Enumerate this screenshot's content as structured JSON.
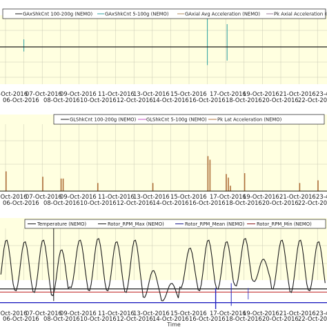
{
  "chart_data": [
    {
      "type": "line",
      "panel": "top",
      "legend": [
        {
          "name": "GAxShkCnt 100-200g (NEMO)",
          "color": "#1a1a1a"
        },
        {
          "name": "GAxShkCnt 5-100g (NEMO)",
          "color": "#2aa0a0"
        },
        {
          "name": "GAxial Avg Acceleration (NEMO)",
          "color": "#b08a5a"
        },
        {
          "name": "Pk Axial Acceleration (NEMO)",
          "color": "#9a7a9a"
        }
      ],
      "legend_placement": "top",
      "grid": true,
      "baseline": 0,
      "spikes": [
        {
          "date": "2016-10-07",
          "value": 1,
          "series": 1
        },
        {
          "date": "2016-10-17",
          "value": 4,
          "series": 1
        },
        {
          "date": "2016-10-18",
          "value": 3,
          "series": 1
        }
      ]
    },
    {
      "type": "bar",
      "panel": "middle",
      "legend": [
        {
          "name": "GLShkCnt 100-200g (NEMO)",
          "color": "#1a1a1a"
        },
        {
          "name": "GLShkCnt 5-100g (NEMO)",
          "color": "#c04fc0"
        },
        {
          "name": "Pk Lat Acceleration (NEMO)",
          "color": "#b0703a"
        }
      ],
      "legend_placement": "top",
      "grid": true,
      "spikes": [
        {
          "date": "2016-10-05",
          "value": 2.0
        },
        {
          "date": "2016-10-05",
          "value": 1.1
        },
        {
          "date": "2016-10-06",
          "value": 2.2
        },
        {
          "date": "2016-10-08",
          "value": 1.6
        },
        {
          "date": "2016-10-09",
          "value": 1.4
        },
        {
          "date": "2016-10-09",
          "value": 1.4
        },
        {
          "date": "2016-10-11",
          "value": 0.9
        },
        {
          "date": "2016-10-14",
          "value": 0.9
        },
        {
          "date": "2016-10-17",
          "value": 3.9
        },
        {
          "date": "2016-10-17",
          "value": 3.5
        },
        {
          "date": "2016-10-18",
          "value": 1.9
        },
        {
          "date": "2016-10-18",
          "value": 1.5
        },
        {
          "date": "2016-10-18",
          "value": 0.6
        },
        {
          "date": "2016-10-19",
          "value": 2.0
        },
        {
          "date": "2016-10-22",
          "value": 0.9
        },
        {
          "date": "2016-10-23",
          "value": 1.2
        }
      ]
    },
    {
      "type": "line",
      "panel": "bottom",
      "legend": [
        {
          "name": "Temperature (NEMO)",
          "color": "#1a1a1a"
        },
        {
          "name": "Rotor_RPM_Max (NEMO)",
          "color": "#1a1a1a"
        },
        {
          "name": "Rotor_RPM_Mean (NEMO)",
          "color": "#1a1a8c"
        },
        {
          "name": "Rotor_RPM_Min (NEMO)",
          "color": "#8c1a1a"
        }
      ],
      "legend_placement": "top",
      "grid": true,
      "xlabel": "Time",
      "temperature_daily": [
        {
          "date": "2016-10-05",
          "high": 4.4,
          "low": 0.9
        },
        {
          "date": "2016-10-06",
          "high": 4.3,
          "low": 1.0
        },
        {
          "date": "2016-10-07",
          "high": 4.2,
          "low": 1.1
        },
        {
          "date": "2016-10-08",
          "high": 4.3,
          "low": 1.0
        },
        {
          "date": "2016-10-09",
          "high": 3.7,
          "low": 0.8
        },
        {
          "date": "2016-10-10",
          "high": 4.3,
          "low": 1.3
        },
        {
          "date": "2016-10-11",
          "high": 4.4,
          "low": 1.1
        },
        {
          "date": "2016-10-12",
          "high": 4.2,
          "low": 1.1
        },
        {
          "date": "2016-10-13",
          "high": 4.3,
          "low": 1.0
        },
        {
          "date": "2016-10-14",
          "high": 2.4,
          "low": 0.7
        },
        {
          "date": "2016-10-15",
          "high": 1.6,
          "low": 0.5
        },
        {
          "date": "2016-10-16",
          "high": 3.8,
          "low": 1.3
        },
        {
          "date": "2016-10-17",
          "high": 4.3,
          "low": 1.1
        },
        {
          "date": "2016-10-18",
          "high": 4.2,
          "low": 1.2
        },
        {
          "date": "2016-10-19",
          "high": 4.4,
          "low": 1.4
        },
        {
          "date": "2016-10-20",
          "high": 3.1,
          "low": 1.7
        },
        {
          "date": "2016-10-21",
          "high": 4.3,
          "low": 1.2
        },
        {
          "date": "2016-10-22",
          "high": 4.3,
          "low": 1.0
        },
        {
          "date": "2016-10-23",
          "high": 4.2,
          "low": 1.1
        }
      ],
      "rotor_rpm_max_level": 1.25,
      "rotor_rpm_mean_level": 0.4,
      "rotor_rpm_min_level": 1.05,
      "marker": {
        "date": "2016-10-09"
      }
    }
  ],
  "x_axis": {
    "row1_ticks": [
      "07-Oct-2016",
      "09-Oct-2016",
      "11-Oct-2016",
      "13-Oct-2016",
      "15-Oct-2016",
      "17-Oct-2016",
      "19-Oct-2016",
      "21-Oct-2016"
    ],
    "row2_ticks": [
      "06-Oct-2016",
      "08-Oct-2016",
      "10-Oct-2016",
      "12-Oct-2016",
      "14-Oct-2016",
      "16-Oct-2016",
      "18-Oct-2016",
      "20-Oct-2016",
      "22-Oct-2016"
    ],
    "panel_top_row1": [
      "-Oct-2016",
      "07-Oct-2016",
      "09-Oct-2016",
      "11-Oct-2016",
      "13-Oct-2016",
      "15-Oct-2016",
      "17-Oct-2016",
      "19-Oct-2016",
      "21-Oct-2016",
      "23-4"
    ],
    "panel_top_row2": [
      "06-Oct-2016",
      "08-Oct-2016",
      "10-Oct-2016",
      "12-Oct-2016",
      "14-Oct-2016",
      "16-Oct-2016",
      "18-Oct-2016",
      "20-Oct-2016",
      "22-Oct-201"
    ],
    "panel_mid_row1": [
      "6-Oct-2016",
      "07-Oct-2016",
      "09-Oct-2016",
      "11-Oct-2016",
      "13-Oct-2016",
      "15-Oct-2016",
      "17-Oct-2016",
      "19-Oct-2016",
      "21-Oct-2016",
      "23-4"
    ],
    "panel_mid_row2": [
      "06-Oct-2016",
      "08-Oct-2016",
      "10-Oct-2016",
      "12-Oct-2016",
      "14-Oct-2016",
      "16-Oct-2016",
      "18-Oct-2016",
      "20-Oct-2016",
      "22-Oct-201"
    ],
    "panel_bot_row1": [
      "6-Oct-2016",
      "07-Oct-2016",
      "09-Oct-2016",
      "11-Oct-2016",
      "13-Oct-2016",
      "15-Oct-2016",
      "17-Oct-2016",
      "19-Oct-2016",
      "21-Oct-2016",
      "23-4"
    ],
    "panel_bot_row2": [
      "06-Oct-2016",
      "08-Oct-2016",
      "10-Oct-2016",
      "12-Oct-2016",
      "14-Oct-2016",
      "16-Oct-2016",
      "18-Oct-2016",
      "20-Oct-2016",
      "22-Oct-201"
    ],
    "range": [
      "2016-10-05",
      "2016-10-24"
    ]
  },
  "colors": {
    "plot_background": "#ffffe0",
    "frame": "#1a1a1a",
    "grid": "#c8c8b4",
    "baseline_dark": "#1a1a1a",
    "baseline_blue": "#2020c0",
    "baseline_red": "#c02020"
  }
}
